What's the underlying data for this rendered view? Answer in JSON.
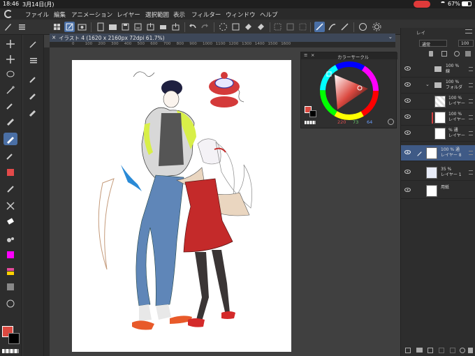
{
  "status_bar": {
    "time": "18:46",
    "date": "3月14日(月)",
    "battery": "67%"
  },
  "menu": {
    "items": [
      "ファイル",
      "編集",
      "アニメーション",
      "レイヤー",
      "選択範囲",
      "表示",
      "フィルター",
      "ウィンドウ",
      "ヘルプ"
    ]
  },
  "document": {
    "tab_label": "イラスト 4 (1620 x 2160px 72dpi 61.7%)",
    "ruler_ticks": [
      "0",
      "100",
      "200",
      "300",
      "400",
      "500",
      "600",
      "700",
      "800",
      "900",
      "1000",
      "1100",
      "1200",
      "1300",
      "1400",
      "1500",
      "1600"
    ]
  },
  "color_palette": {
    "title": "カラーサークル",
    "r": "220",
    "g": "73",
    "b": "64",
    "main_color": "#dc4940",
    "sub_color": "#000000"
  },
  "layer_panel": {
    "tab_label": "レイ",
    "blend_mode": "通常",
    "opacity": "100",
    "layers": [
      {
        "line1": "100 %",
        "line2": "線",
        "type": "folder"
      },
      {
        "line1": "100 %",
        "line2": "フォルダ",
        "type": "folder"
      },
      {
        "line1": "100 %",
        "line2": "レイヤー",
        "type": "layer"
      },
      {
        "line1": "100 %",
        "line2": "レイヤー",
        "type": "layer"
      },
      {
        "line1": "% 通",
        "line2": "レイヤー",
        "type": "layer"
      },
      {
        "line1": "100 % 通",
        "line2": "レイヤー 8",
        "type": "layer"
      },
      {
        "line1": "35 %",
        "line2": "レイヤー 1",
        "type": "layer"
      },
      {
        "line1": "",
        "line2": "用紙",
        "type": "paper"
      }
    ]
  }
}
